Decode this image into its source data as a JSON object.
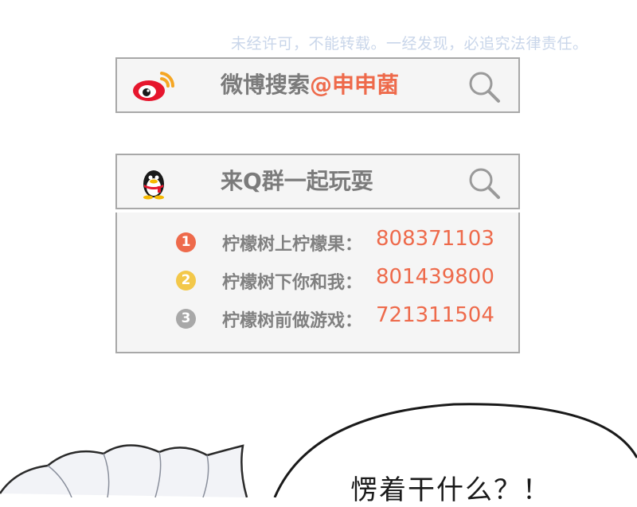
{
  "watermark": "未经许可，不能转载。一经发现，必追究法律责任。",
  "weibo": {
    "logo_icon": "weibo-logo-icon",
    "prefix": "微博搜索",
    "handle": "@申申菌",
    "search_icon": "magnifier-icon"
  },
  "qq": {
    "logo_icon": "qq-penguin-icon",
    "label": "来Q群一起玩耍",
    "search_icon": "magnifier-icon",
    "groups": [
      {
        "badge": "1",
        "name": "柠檬树上柠檬果：",
        "number": "808371103",
        "color": "#ee6a4b"
      },
      {
        "badge": "2",
        "name": "柠檬树下你和我：",
        "number": "801439800",
        "color": "#f3c84a"
      },
      {
        "badge": "3",
        "name": "柠檬树前做游戏：",
        "number": "721311504",
        "color": "#a8a8a8"
      }
    ]
  },
  "comic": {
    "speech": "愣着干什么？！"
  }
}
